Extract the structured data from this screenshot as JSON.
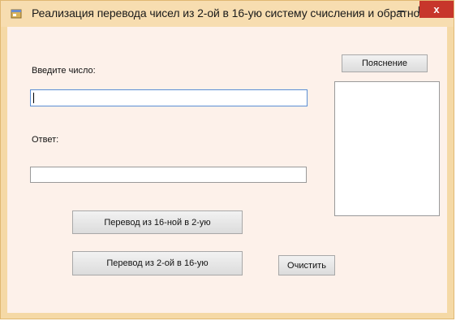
{
  "window": {
    "title": "Реализация перевода чисел из 2-ой в 16-ую систему счисления и обратно",
    "close_glyph": "x",
    "icon": "app-form-icon",
    "colors": {
      "titlebar": "#f7ddb0",
      "client": "#fdf1ea",
      "close": "#c7362b"
    }
  },
  "form": {
    "input_label": "Введите число:",
    "input_value": "",
    "answer_label": "Ответ:",
    "answer_value": "",
    "explain_button": "Пояснение",
    "hex_to_bin_button": "Перевод из 16-ной в 2-ую",
    "bin_to_hex_button": "Перевод из 2-ой в 16-ую",
    "clear_button": "Очистить"
  }
}
